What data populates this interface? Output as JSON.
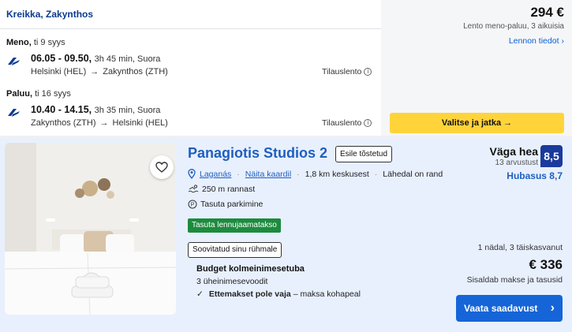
{
  "flight": {
    "destination": "Kreikka, Zakynthos",
    "outbound": {
      "label": "Meno,",
      "date": "ti 9 syys",
      "times": "06.05 - 09.50,",
      "duration": "3h 45 min, Suora",
      "from": "Helsinki (HEL)",
      "to": "Zakynthos (ZTH)",
      "charter": "Tilauslento"
    },
    "return": {
      "label": "Paluu,",
      "date": "ti 16 syys",
      "times": "10.40 - 14.15,",
      "duration": "3h 35 min, Suora",
      "from": "Zakynthos (ZTH)",
      "to": "Helsinki (HEL)",
      "charter": "Tilauslento"
    },
    "price": "294 €",
    "price_note": "Lento meno-paluu, 3 aikuisia",
    "details_link": "Lennon tiedot",
    "select_button": "Valitse ja jatka →",
    "route_arrow": "→",
    "chevron": "›",
    "info_glyph": "i",
    "airline_icon": "finnair-logo-icon"
  },
  "hotel": {
    "name": "Panagiotis Studios 2",
    "featured_badge": "Esile tõstetud",
    "location": "Laganás",
    "map_link": "Näita kaardil",
    "distance": "1,8 km keskusest",
    "beach": "Lähedal on rand",
    "beach_distance": "250 m rannast",
    "parking": "Tasuta parkimine",
    "airport_taxi": "Tasuta lennujaamatakso",
    "group_badge": "Soovitatud sinu rühmale",
    "room_type": "Budget kolmeinimesetuba",
    "beds": "3 üheinimesevoodit",
    "prepay_bold": "Ettemakset pole vaja",
    "prepay_rest": "– maksa kohapeal",
    "rating_word": "Väga hea",
    "rating_count": "13 arvustust",
    "rating_score": "8,5",
    "value_score": "Hubasus 8,7",
    "stay_info": "1 nädal, 3 täiskasvanut",
    "price": "€ 336",
    "tax_note": "Sisaldab makse ja tasusid",
    "availability_button": "Vaata saadavust",
    "chevron": "›",
    "checkmark": "✓",
    "icons": [
      "heart-icon",
      "map-pin-icon",
      "swimmer-icon",
      "parking-icon",
      "checkmark-icon"
    ]
  },
  "colors": {
    "brand_blue": "#1f5fbf",
    "select_yellow": "#ffd43b",
    "rating_navy": "#1a3a9c",
    "badge_green": "#1c8b3d",
    "button_blue": "#1565d8",
    "hotel_bg": "#e8f0fe"
  }
}
